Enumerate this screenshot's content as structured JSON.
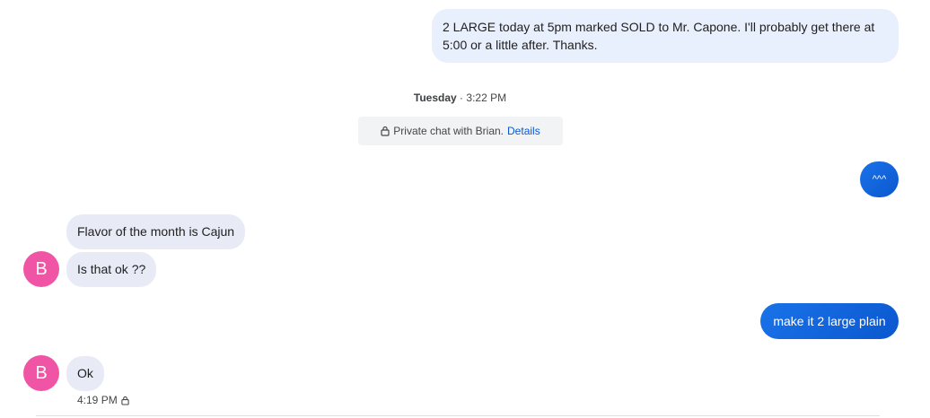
{
  "messages": {
    "out_1": "2 LARGE today at 5pm marked SOLD to Mr. Capone. I'll probably get there at 5:00 or a little after. Thanks.",
    "out_2": "^^^",
    "in_1": "Flavor of the month is Cajun",
    "in_2": "Is that ok ??",
    "out_3": "make it 2 large plain",
    "in_3": "Ok"
  },
  "divider": {
    "day": "Tuesday",
    "separator": "·",
    "time": "3:22 PM"
  },
  "private_notice": {
    "text": "Private chat with Brian.",
    "link": "Details"
  },
  "contact": {
    "initial": "B",
    "avatar_color": "#f054a5"
  },
  "last_timestamp": "4:19 PM",
  "colors": {
    "outgoing_light": "#e8effd",
    "outgoing_blue": "#0b57d0",
    "incoming": "#e8eaf6",
    "link": "#0b57d0"
  },
  "icons": [
    "lock-icon"
  ]
}
